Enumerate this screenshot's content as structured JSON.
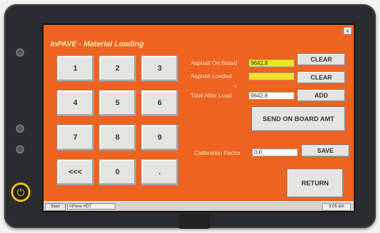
{
  "app": {
    "title": "InPAVE - Material Loading"
  },
  "keypad": {
    "keys": [
      "1",
      "2",
      "3",
      "4",
      "5",
      "6",
      "7",
      "8",
      "9",
      "<<<",
      "0",
      "."
    ]
  },
  "fields": {
    "asphalt_on_board_label": "Asphalt On Board",
    "asphalt_on_board_value": "9642.8",
    "asphalt_loaded_label": "Asphalt Loaded",
    "asphalt_loaded_value": "",
    "plus_sign": "+",
    "total_after_load_label": "Total After Load",
    "total_after_load_value": "9642.8",
    "calibration_factor_label": "Calibration Factor",
    "calibration_factor_value": "0.0"
  },
  "buttons": {
    "clear_1": "CLEAR",
    "clear_2": "CLEAR",
    "add": "ADD",
    "send_on_board": "SEND ON BOARD AMT",
    "save": "SAVE",
    "return": "RETURN"
  },
  "taskbar": {
    "start": "Start",
    "task": "InPave HDT",
    "clock": "9:05 am"
  },
  "colors": {
    "background": "#ee6320",
    "field_highlight": "#f0e41c",
    "power_ring": "#e8c21c"
  }
}
